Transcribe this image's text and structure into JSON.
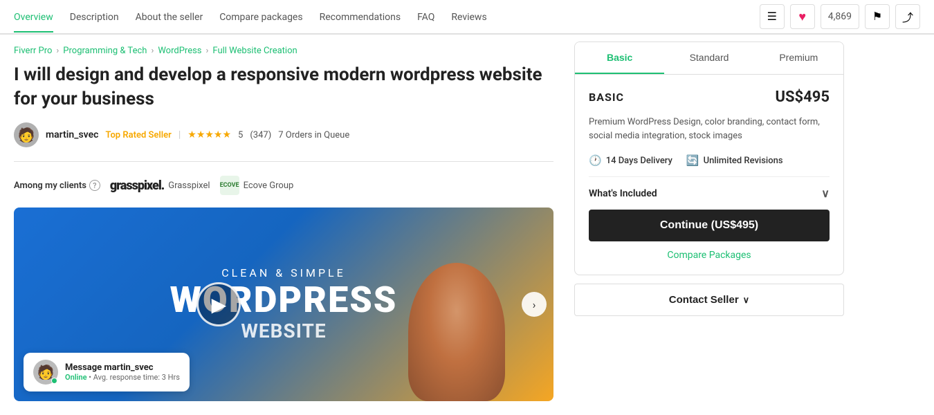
{
  "nav": {
    "links": [
      {
        "label": "Overview",
        "active": true
      },
      {
        "label": "Description",
        "active": false
      },
      {
        "label": "About the seller",
        "active": false
      },
      {
        "label": "Compare packages",
        "active": false
      },
      {
        "label": "Recommendations",
        "active": false
      },
      {
        "label": "FAQ",
        "active": false
      },
      {
        "label": "Reviews",
        "active": false
      }
    ],
    "heart_icon": "♥",
    "count": "4,869",
    "menu_icon": "☰",
    "flag_icon": "⚑",
    "share_icon": "⤴"
  },
  "breadcrumb": {
    "items": [
      "Fiverr Pro",
      "Programming & Tech",
      "WordPress",
      "Full Website Creation"
    ]
  },
  "left": {
    "title": "I will design and develop a responsive modern wordpress website for your business",
    "seller": {
      "name": "martin_svec",
      "badge": "Top Rated Seller",
      "stars": "★★★★★",
      "rating": "5",
      "review_count": "(347)",
      "queue": "7 Orders in Queue"
    },
    "clients_label": "Among my clients",
    "clients": [
      {
        "name": "Grasspixel",
        "logo": "grasspixel."
      },
      {
        "name": "Ecove Group",
        "logo": "ECOVE"
      }
    ],
    "video": {
      "subtitle": "CLEAN & SIMPLE",
      "title": "WORDPRESS",
      "person_face": "😊"
    },
    "message": {
      "name": "Message martin_svec",
      "status": "Online",
      "response": "Avg. response time: 3 Hrs"
    }
  },
  "right": {
    "tabs": [
      "Basic",
      "Standard",
      "Premium"
    ],
    "active_tab": "Basic",
    "package": {
      "name": "BASIC",
      "price": "US$495",
      "description": "Premium WordPress Design, color branding, contact form, social media integration, stock images",
      "delivery": "14 Days Delivery",
      "revisions": "Unlimited Revisions",
      "whats_included": "What's Included",
      "continue_btn": "Continue (US$495)",
      "compare_link": "Compare Packages"
    },
    "contact_btn": "Contact Seller"
  }
}
